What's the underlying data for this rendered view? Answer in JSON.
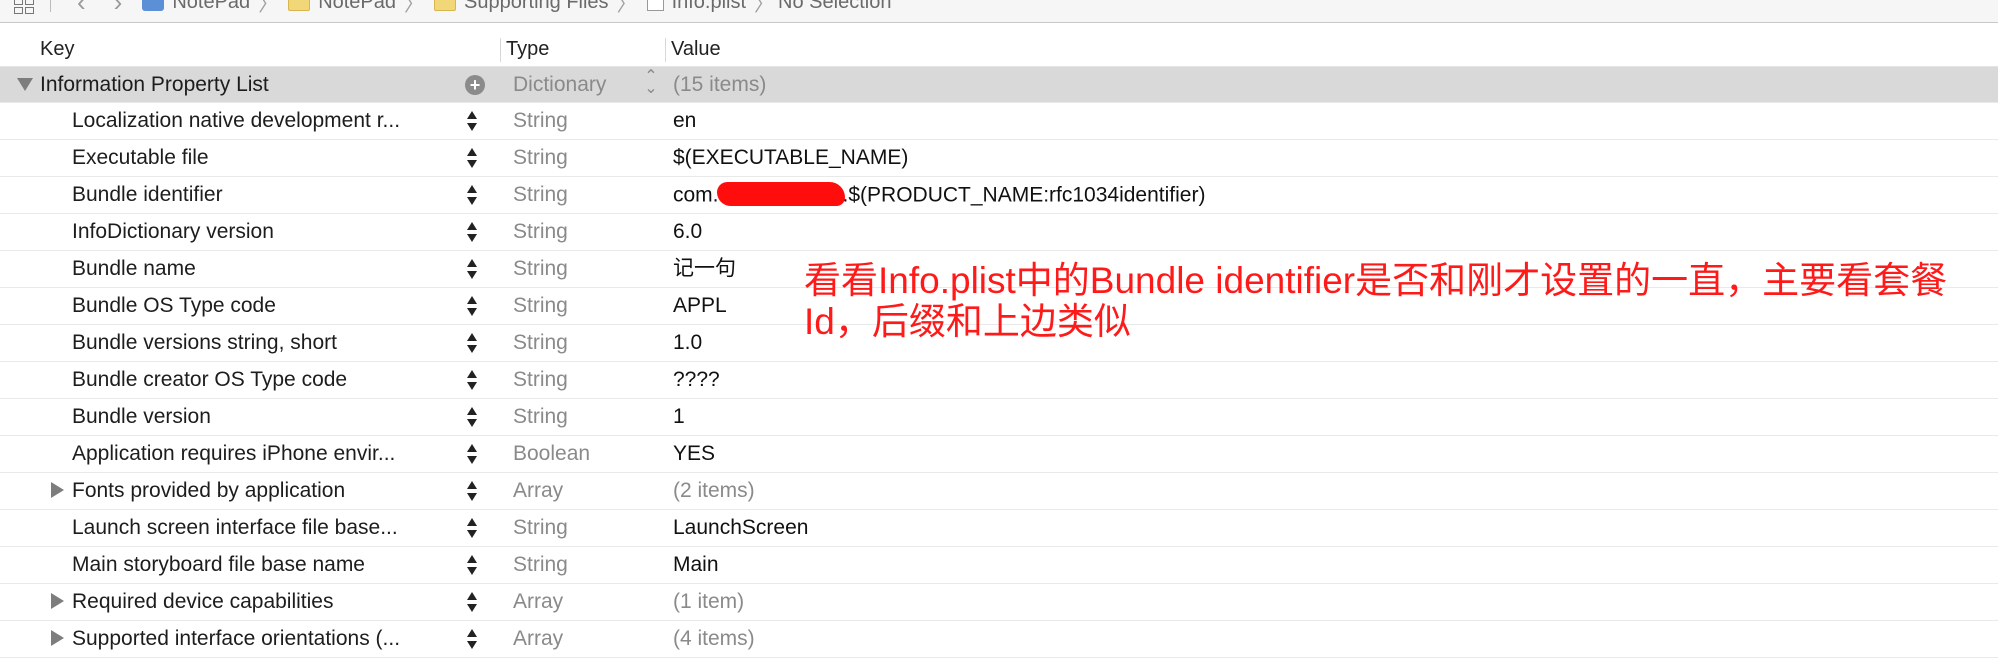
{
  "jumpbar": {
    "project": "NotePad",
    "group": "NotePad",
    "folder": "Supporting Files",
    "file": "Info.plist",
    "selection": "No Selection"
  },
  "columns": {
    "key": "Key",
    "type": "Type",
    "value": "Value"
  },
  "root": {
    "key": "Information Property List",
    "type": "Dictionary",
    "value": "(15 items)"
  },
  "rows": [
    {
      "key": "Localization native development r...",
      "type": "String",
      "value": "en"
    },
    {
      "key": "Executable file",
      "type": "String",
      "value": "$(EXECUTABLE_NAME)"
    },
    {
      "key": "Bundle identifier",
      "type": "String",
      "value_prefix": "com.",
      "value_suffix": ".$(PRODUCT_NAME:rfc1034identifier)"
    },
    {
      "key": "InfoDictionary version",
      "type": "String",
      "value": "6.0"
    },
    {
      "key": "Bundle name",
      "type": "String",
      "value": "记一句"
    },
    {
      "key": "Bundle OS Type code",
      "type": "String",
      "value": "APPL"
    },
    {
      "key": "Bundle versions string, short",
      "type": "String",
      "value": "1.0"
    },
    {
      "key": "Bundle creator OS Type code",
      "type": "String",
      "value": "????"
    },
    {
      "key": "Bundle version",
      "type": "String",
      "value": "1"
    },
    {
      "key": "Application requires iPhone envir...",
      "type": "Boolean",
      "value": "YES"
    },
    {
      "key": "Fonts provided by application",
      "type": "Array",
      "value": "(2 items)"
    },
    {
      "key": "Launch screen interface file base...",
      "type": "String",
      "value": "LaunchScreen"
    },
    {
      "key": "Main storyboard file base name",
      "type": "String",
      "value": "Main"
    },
    {
      "key": "Required device capabilities",
      "type": "Array",
      "value": "(1 item)"
    },
    {
      "key": "Supported interface orientations (...",
      "type": "Array",
      "value": "(4 items)"
    }
  ],
  "annotation": "看看Info.plist中的Bundle identifier是否和刚才设置的一直，主要看套餐Id，后缀和上边类似",
  "colors": {
    "annotation": "#ff1a1a",
    "redaction": "#ff0d0d",
    "root_row_bg": "#d9d9d9"
  }
}
